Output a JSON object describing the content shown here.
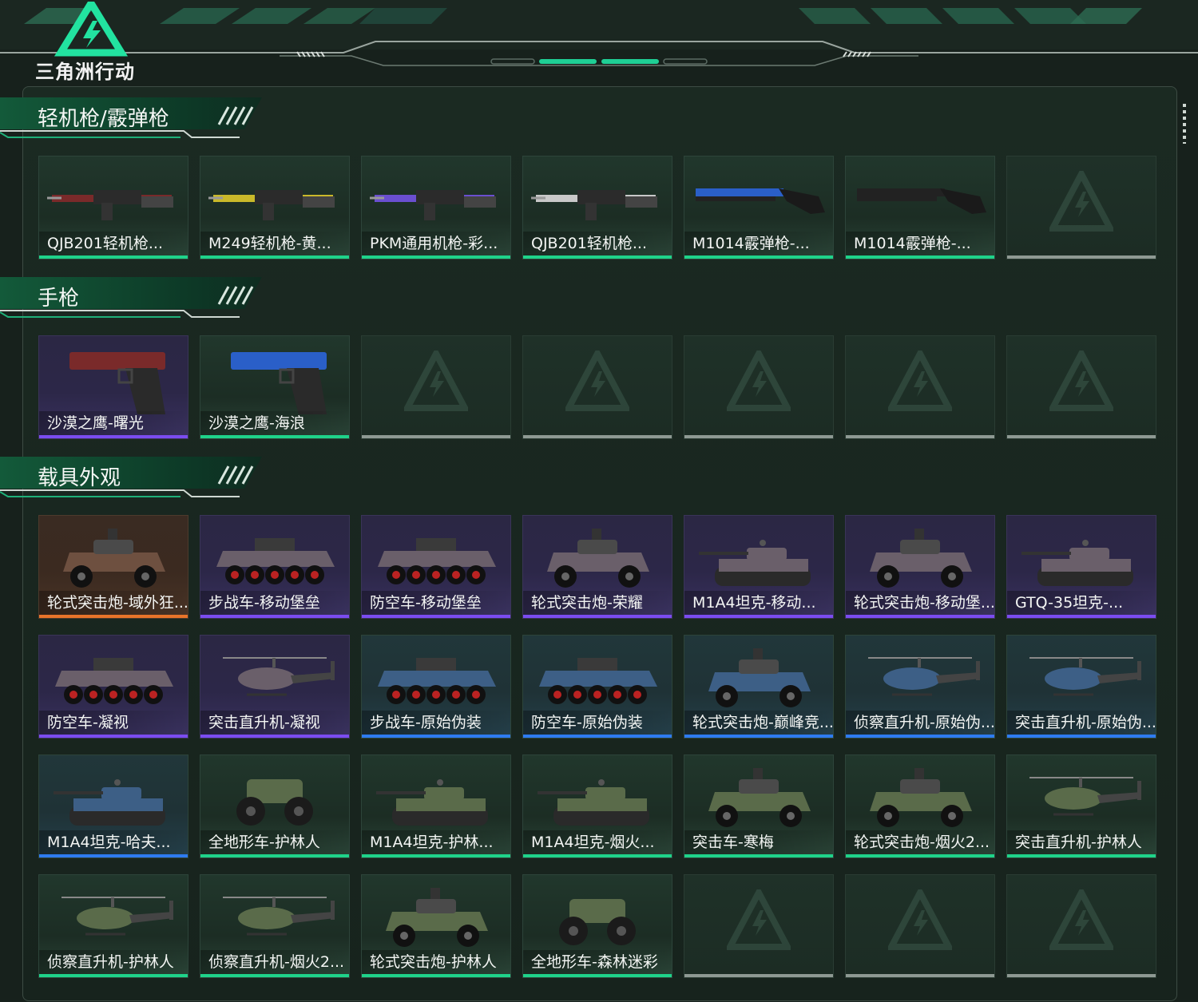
{
  "header": {
    "logo_text": "三角洲行动",
    "logo_icon": "delta-triangle-icon"
  },
  "colors": {
    "green": "#1fd38a",
    "purple": "#7b4cf0",
    "blue": "#2e7bf0",
    "orange": "#e8742a",
    "gray": "#8e9993"
  },
  "sections": [
    {
      "title": "轻机枪/霰弹枪",
      "items": [
        {
          "label": "QJB201轻机枪...",
          "rarity": "green",
          "icon": "machine-gun-icon"
        },
        {
          "label": "M249轻机枪-黄...",
          "rarity": "green",
          "icon": "machine-gun-icon"
        },
        {
          "label": "PKM通用机枪-彩...",
          "rarity": "green",
          "icon": "machine-gun-icon"
        },
        {
          "label": "QJB201轻机枪...",
          "rarity": "green",
          "icon": "machine-gun-icon"
        },
        {
          "label": "M1014霰弹枪-...",
          "rarity": "green",
          "icon": "shotgun-icon"
        },
        {
          "label": "M1014霰弹枪-...",
          "rarity": "green",
          "icon": "shotgun-icon"
        },
        {
          "label": "",
          "rarity": "gray",
          "icon": "empty-slot-icon"
        }
      ]
    },
    {
      "title": "手枪",
      "items": [
        {
          "label": "沙漠之鹰-曙光",
          "rarity": "purple",
          "icon": "pistol-icon"
        },
        {
          "label": "沙漠之鹰-海浪",
          "rarity": "green",
          "icon": "pistol-icon"
        },
        {
          "label": "",
          "rarity": "gray",
          "icon": "empty-slot-icon"
        },
        {
          "label": "",
          "rarity": "gray",
          "icon": "empty-slot-icon"
        },
        {
          "label": "",
          "rarity": "gray",
          "icon": "empty-slot-icon"
        },
        {
          "label": "",
          "rarity": "gray",
          "icon": "empty-slot-icon"
        },
        {
          "label": "",
          "rarity": "gray",
          "icon": "empty-slot-icon"
        }
      ]
    },
    {
      "title": "载具外观",
      "items": [
        {
          "label": "轮式突击炮-域外狂...",
          "rarity": "orange",
          "icon": "wheeled-vehicle-icon"
        },
        {
          "label": "步战车-移动堡垒",
          "rarity": "purple",
          "icon": "apc-icon"
        },
        {
          "label": "防空车-移动堡垒",
          "rarity": "purple",
          "icon": "apc-icon"
        },
        {
          "label": "轮式突击炮-荣耀",
          "rarity": "purple",
          "icon": "wheeled-vehicle-icon"
        },
        {
          "label": "M1A4坦克-移动...",
          "rarity": "purple",
          "icon": "tank-icon"
        },
        {
          "label": "轮式突击炮-移动堡...",
          "rarity": "purple",
          "icon": "wheeled-vehicle-icon"
        },
        {
          "label": "GTQ-35坦克-...",
          "rarity": "purple",
          "icon": "tank-icon"
        },
        {
          "label": "防空车-凝视",
          "rarity": "purple",
          "icon": "apc-icon"
        },
        {
          "label": "突击直升机-凝视",
          "rarity": "purple",
          "icon": "helicopter-icon"
        },
        {
          "label": "步战车-原始伪装",
          "rarity": "blue",
          "icon": "apc-icon"
        },
        {
          "label": "防空车-原始伪装",
          "rarity": "blue",
          "icon": "apc-icon"
        },
        {
          "label": "轮式突击炮-巅峰竞...",
          "rarity": "blue",
          "icon": "wheeled-vehicle-icon"
        },
        {
          "label": "侦察直升机-原始伪...",
          "rarity": "blue",
          "icon": "helicopter-icon"
        },
        {
          "label": "突击直升机-原始伪...",
          "rarity": "blue",
          "icon": "helicopter-icon"
        },
        {
          "label": "M1A4坦克-哈夫...",
          "rarity": "blue",
          "icon": "tank-icon"
        },
        {
          "label": "全地形车-护林人",
          "rarity": "green",
          "icon": "atv-icon"
        },
        {
          "label": "M1A4坦克-护林...",
          "rarity": "green",
          "icon": "tank-icon"
        },
        {
          "label": "M1A4坦克-烟火...",
          "rarity": "green",
          "icon": "tank-icon"
        },
        {
          "label": "突击车-寒梅",
          "rarity": "green",
          "icon": "wheeled-vehicle-icon"
        },
        {
          "label": "轮式突击炮-烟火2...",
          "rarity": "green",
          "icon": "wheeled-vehicle-icon"
        },
        {
          "label": "突击直升机-护林人",
          "rarity": "green",
          "icon": "helicopter-icon"
        },
        {
          "label": "侦察直升机-护林人",
          "rarity": "green",
          "icon": "helicopter-icon"
        },
        {
          "label": "侦察直升机-烟火2...",
          "rarity": "green",
          "icon": "helicopter-icon"
        },
        {
          "label": "轮式突击炮-护林人",
          "rarity": "green",
          "icon": "wheeled-vehicle-icon"
        },
        {
          "label": "全地形车-森林迷彩",
          "rarity": "green",
          "icon": "atv-icon"
        },
        {
          "label": "",
          "rarity": "gray",
          "icon": "empty-slot-icon"
        },
        {
          "label": "",
          "rarity": "gray",
          "icon": "empty-slot-icon"
        },
        {
          "label": "",
          "rarity": "gray",
          "icon": "empty-slot-icon"
        }
      ]
    }
  ]
}
